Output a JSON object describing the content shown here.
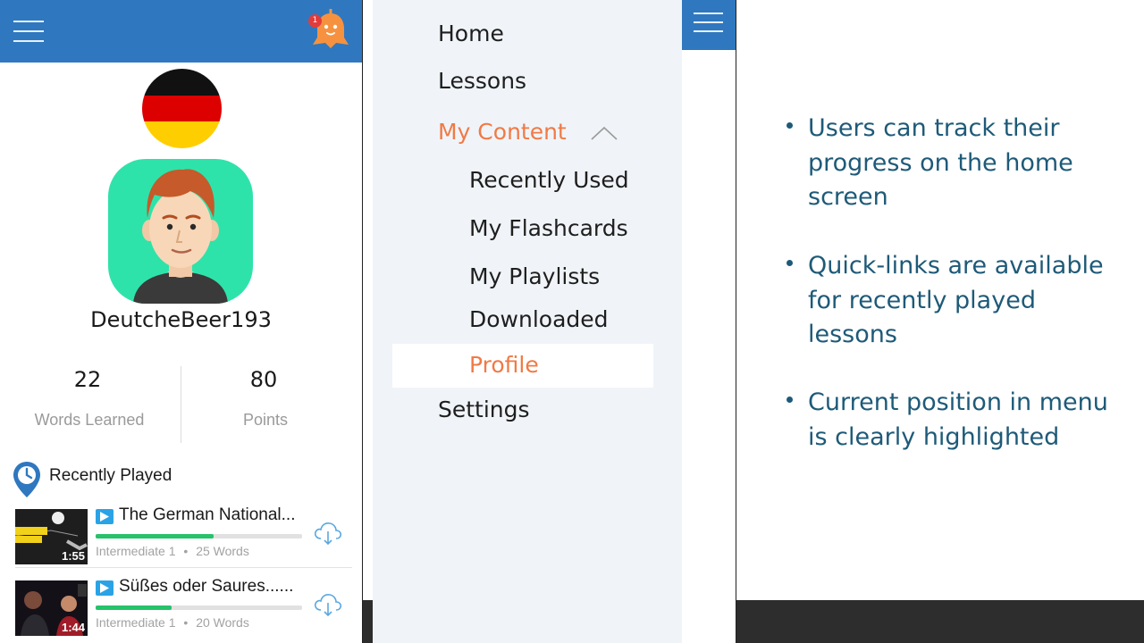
{
  "home": {
    "notification_count": "1",
    "username": "DeutcheBeer193",
    "stats": [
      {
        "value": "22",
        "label": "Words Learned"
      },
      {
        "value": "80",
        "label": "Points"
      }
    ],
    "recently_played_title": "Recently Played",
    "lessons": [
      {
        "title": "The German National...",
        "level": "Intermediate 1",
        "words": "25 Words",
        "duration": "1:55",
        "progress": 0.57
      },
      {
        "title": "Süßes oder Saures......",
        "level": "Intermediate 1",
        "words": "20 Words",
        "duration": "1:44",
        "progress": 0.37
      }
    ],
    "meta_separator": "•"
  },
  "menu": {
    "items": {
      "home": "Home",
      "lessons": "Lessons",
      "my_content": "My Content",
      "recently_used": "Recently Used",
      "my_flashcards": "My Flashcards",
      "my_playlists": "My Playlists",
      "downloaded": "Downloaded",
      "profile": "Profile",
      "settings": "Settings"
    },
    "active_item": "Profile"
  },
  "notes": {
    "bullets": [
      "Users can track their progress on the home screen",
      "Quick-links are available for recently played lessons",
      "Current position in menu is clearly highlighted"
    ]
  },
  "colors": {
    "brand_blue": "#2f78bf",
    "accent_orange": "#f07a45",
    "progress_green": "#27c26b",
    "note_text": "#1e5a78"
  },
  "icons": [
    "hamburger-menu-icon",
    "notification-bell-icon",
    "germany-flag-icon",
    "user-avatar-icon",
    "clock-pin-icon",
    "play-icon",
    "cloud-download-icon",
    "chevron-up-icon"
  ]
}
